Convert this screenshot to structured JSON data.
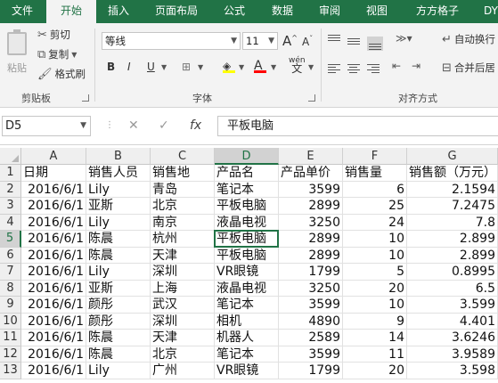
{
  "tabs": [
    "文件",
    "开始",
    "插入",
    "页面布局",
    "公式",
    "数据",
    "审阅",
    "视图",
    "方方格子",
    "DY"
  ],
  "clipboard": {
    "paste": "粘贴",
    "cut": "剪切",
    "copy": "复制",
    "format_painter": "格式刷",
    "group": "剪贴板"
  },
  "font": {
    "name": "等线",
    "size": "11",
    "group": "字体",
    "bold": "B",
    "italic": "I",
    "underline": "U",
    "grow": "A",
    "shrink": "A",
    "color_letter": "A",
    "wen": "wén",
    "font_color": "#ff0000"
  },
  "alignment": {
    "wrap": "自动换行",
    "merge": "合并后居",
    "group": "对齐方式"
  },
  "namebox": "D5",
  "formula": "平板电脑",
  "columns": [
    "A",
    "B",
    "C",
    "D",
    "E",
    "F",
    "G"
  ],
  "selected_column": "D",
  "selected_row": "5",
  "rows": [
    {
      "n": "1",
      "a": "日期",
      "b": "销售人员",
      "c": "销售地",
      "d": "产品名",
      "e": "产品单价",
      "f": "销售量",
      "g": "销售额（万元）"
    },
    {
      "n": "2",
      "a": "2016/6/1",
      "b": "Lily",
      "c": "青岛",
      "d": "笔记本",
      "e": "3599",
      "f": "6",
      "g": "2.1594"
    },
    {
      "n": "3",
      "a": "2016/6/1",
      "b": "亚斯",
      "c": "北京",
      "d": "平板电脑",
      "e": "2899",
      "f": "25",
      "g": "7.2475"
    },
    {
      "n": "4",
      "a": "2016/6/1",
      "b": "Lily",
      "c": "南京",
      "d": "液晶电视",
      "e": "3250",
      "f": "24",
      "g": "7.8"
    },
    {
      "n": "5",
      "a": "2016/6/1",
      "b": "陈晨",
      "c": "杭州",
      "d": "平板电脑",
      "e": "2899",
      "f": "10",
      "g": "2.899"
    },
    {
      "n": "6",
      "a": "2016/6/1",
      "b": "陈晨",
      "c": "天津",
      "d": "平板电脑",
      "e": "2899",
      "f": "10",
      "g": "2.899"
    },
    {
      "n": "7",
      "a": "2016/6/1",
      "b": "Lily",
      "c": "深圳",
      "d": "VR眼镜",
      "e": "1799",
      "f": "5",
      "g": "0.8995"
    },
    {
      "n": "8",
      "a": "2016/6/1",
      "b": "亚斯",
      "c": "上海",
      "d": "液晶电视",
      "e": "3250",
      "f": "20",
      "g": "6.5"
    },
    {
      "n": "9",
      "a": "2016/6/1",
      "b": "颜彤",
      "c": "武汉",
      "d": "笔记本",
      "e": "3599",
      "f": "10",
      "g": "3.599"
    },
    {
      "n": "10",
      "a": "2016/6/1",
      "b": "颜彤",
      "c": "深圳",
      "d": "相机",
      "e": "4890",
      "f": "9",
      "g": "4.401"
    },
    {
      "n": "11",
      "a": "2016/6/1",
      "b": "陈晨",
      "c": "天津",
      "d": "机器人",
      "e": "2589",
      "f": "14",
      "g": "3.6246"
    },
    {
      "n": "12",
      "a": "2016/6/1",
      "b": "陈晨",
      "c": "北京",
      "d": "笔记本",
      "e": "3599",
      "f": "11",
      "g": "3.9589"
    },
    {
      "n": "13",
      "a": "2016/6/1",
      "b": "Lily",
      "c": "广州",
      "d": "VR眼镜",
      "e": "1799",
      "f": "20",
      "g": "3.598"
    }
  ],
  "accent_color": "#217346"
}
